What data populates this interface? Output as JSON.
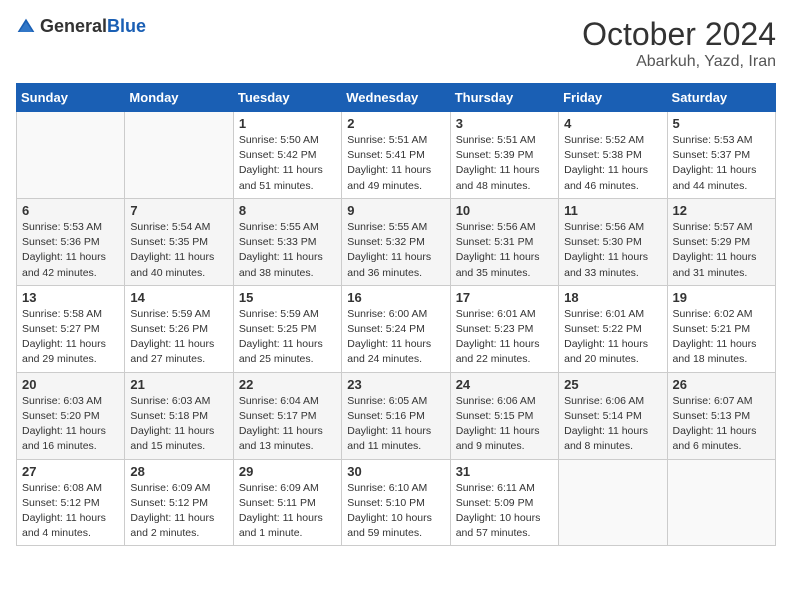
{
  "logo": {
    "general": "General",
    "blue": "Blue"
  },
  "title": "October 2024",
  "subtitle": "Abarkuh, Yazd, Iran",
  "header_days": [
    "Sunday",
    "Monday",
    "Tuesday",
    "Wednesday",
    "Thursday",
    "Friday",
    "Saturday"
  ],
  "weeks": [
    [
      {
        "day": "",
        "info": ""
      },
      {
        "day": "",
        "info": ""
      },
      {
        "day": "1",
        "info": "Sunrise: 5:50 AM\nSunset: 5:42 PM\nDaylight: 11 hours and 51 minutes."
      },
      {
        "day": "2",
        "info": "Sunrise: 5:51 AM\nSunset: 5:41 PM\nDaylight: 11 hours and 49 minutes."
      },
      {
        "day": "3",
        "info": "Sunrise: 5:51 AM\nSunset: 5:39 PM\nDaylight: 11 hours and 48 minutes."
      },
      {
        "day": "4",
        "info": "Sunrise: 5:52 AM\nSunset: 5:38 PM\nDaylight: 11 hours and 46 minutes."
      },
      {
        "day": "5",
        "info": "Sunrise: 5:53 AM\nSunset: 5:37 PM\nDaylight: 11 hours and 44 minutes."
      }
    ],
    [
      {
        "day": "6",
        "info": "Sunrise: 5:53 AM\nSunset: 5:36 PM\nDaylight: 11 hours and 42 minutes."
      },
      {
        "day": "7",
        "info": "Sunrise: 5:54 AM\nSunset: 5:35 PM\nDaylight: 11 hours and 40 minutes."
      },
      {
        "day": "8",
        "info": "Sunrise: 5:55 AM\nSunset: 5:33 PM\nDaylight: 11 hours and 38 minutes."
      },
      {
        "day": "9",
        "info": "Sunrise: 5:55 AM\nSunset: 5:32 PM\nDaylight: 11 hours and 36 minutes."
      },
      {
        "day": "10",
        "info": "Sunrise: 5:56 AM\nSunset: 5:31 PM\nDaylight: 11 hours and 35 minutes."
      },
      {
        "day": "11",
        "info": "Sunrise: 5:56 AM\nSunset: 5:30 PM\nDaylight: 11 hours and 33 minutes."
      },
      {
        "day": "12",
        "info": "Sunrise: 5:57 AM\nSunset: 5:29 PM\nDaylight: 11 hours and 31 minutes."
      }
    ],
    [
      {
        "day": "13",
        "info": "Sunrise: 5:58 AM\nSunset: 5:27 PM\nDaylight: 11 hours and 29 minutes."
      },
      {
        "day": "14",
        "info": "Sunrise: 5:59 AM\nSunset: 5:26 PM\nDaylight: 11 hours and 27 minutes."
      },
      {
        "day": "15",
        "info": "Sunrise: 5:59 AM\nSunset: 5:25 PM\nDaylight: 11 hours and 25 minutes."
      },
      {
        "day": "16",
        "info": "Sunrise: 6:00 AM\nSunset: 5:24 PM\nDaylight: 11 hours and 24 minutes."
      },
      {
        "day": "17",
        "info": "Sunrise: 6:01 AM\nSunset: 5:23 PM\nDaylight: 11 hours and 22 minutes."
      },
      {
        "day": "18",
        "info": "Sunrise: 6:01 AM\nSunset: 5:22 PM\nDaylight: 11 hours and 20 minutes."
      },
      {
        "day": "19",
        "info": "Sunrise: 6:02 AM\nSunset: 5:21 PM\nDaylight: 11 hours and 18 minutes."
      }
    ],
    [
      {
        "day": "20",
        "info": "Sunrise: 6:03 AM\nSunset: 5:20 PM\nDaylight: 11 hours and 16 minutes."
      },
      {
        "day": "21",
        "info": "Sunrise: 6:03 AM\nSunset: 5:18 PM\nDaylight: 11 hours and 15 minutes."
      },
      {
        "day": "22",
        "info": "Sunrise: 6:04 AM\nSunset: 5:17 PM\nDaylight: 11 hours and 13 minutes."
      },
      {
        "day": "23",
        "info": "Sunrise: 6:05 AM\nSunset: 5:16 PM\nDaylight: 11 hours and 11 minutes."
      },
      {
        "day": "24",
        "info": "Sunrise: 6:06 AM\nSunset: 5:15 PM\nDaylight: 11 hours and 9 minutes."
      },
      {
        "day": "25",
        "info": "Sunrise: 6:06 AM\nSunset: 5:14 PM\nDaylight: 11 hours and 8 minutes."
      },
      {
        "day": "26",
        "info": "Sunrise: 6:07 AM\nSunset: 5:13 PM\nDaylight: 11 hours and 6 minutes."
      }
    ],
    [
      {
        "day": "27",
        "info": "Sunrise: 6:08 AM\nSunset: 5:12 PM\nDaylight: 11 hours and 4 minutes."
      },
      {
        "day": "28",
        "info": "Sunrise: 6:09 AM\nSunset: 5:12 PM\nDaylight: 11 hours and 2 minutes."
      },
      {
        "day": "29",
        "info": "Sunrise: 6:09 AM\nSunset: 5:11 PM\nDaylight: 11 hours and 1 minute."
      },
      {
        "day": "30",
        "info": "Sunrise: 6:10 AM\nSunset: 5:10 PM\nDaylight: 10 hours and 59 minutes."
      },
      {
        "day": "31",
        "info": "Sunrise: 6:11 AM\nSunset: 5:09 PM\nDaylight: 10 hours and 57 minutes."
      },
      {
        "day": "",
        "info": ""
      },
      {
        "day": "",
        "info": ""
      }
    ]
  ]
}
